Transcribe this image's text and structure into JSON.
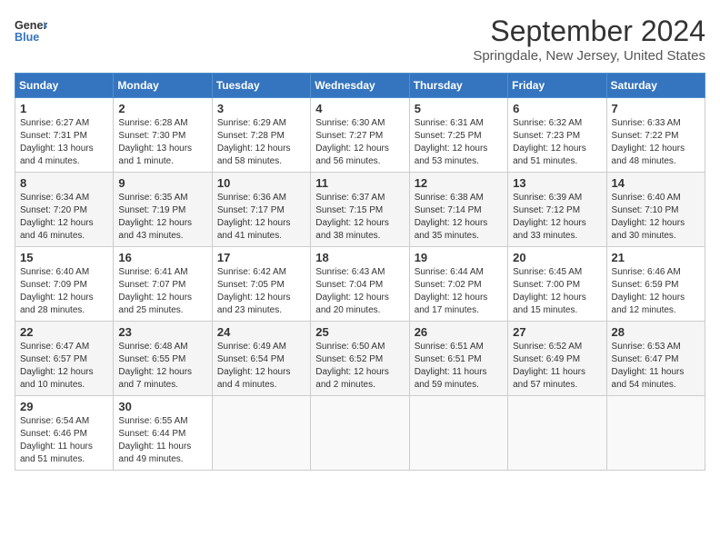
{
  "header": {
    "logo_line1": "General",
    "logo_line2": "Blue",
    "month": "September 2024",
    "location": "Springdale, New Jersey, United States"
  },
  "days_of_week": [
    "Sunday",
    "Monday",
    "Tuesday",
    "Wednesday",
    "Thursday",
    "Friday",
    "Saturday"
  ],
  "weeks": [
    [
      {
        "num": "1",
        "sunrise": "6:27 AM",
        "sunset": "7:31 PM",
        "daylight": "13 hours and 4 minutes."
      },
      {
        "num": "2",
        "sunrise": "6:28 AM",
        "sunset": "7:30 PM",
        "daylight": "13 hours and 1 minute."
      },
      {
        "num": "3",
        "sunrise": "6:29 AM",
        "sunset": "7:28 PM",
        "daylight": "12 hours and 58 minutes."
      },
      {
        "num": "4",
        "sunrise": "6:30 AM",
        "sunset": "7:27 PM",
        "daylight": "12 hours and 56 minutes."
      },
      {
        "num": "5",
        "sunrise": "6:31 AM",
        "sunset": "7:25 PM",
        "daylight": "12 hours and 53 minutes."
      },
      {
        "num": "6",
        "sunrise": "6:32 AM",
        "sunset": "7:23 PM",
        "daylight": "12 hours and 51 minutes."
      },
      {
        "num": "7",
        "sunrise": "6:33 AM",
        "sunset": "7:22 PM",
        "daylight": "12 hours and 48 minutes."
      }
    ],
    [
      {
        "num": "8",
        "sunrise": "6:34 AM",
        "sunset": "7:20 PM",
        "daylight": "12 hours and 46 minutes."
      },
      {
        "num": "9",
        "sunrise": "6:35 AM",
        "sunset": "7:19 PM",
        "daylight": "12 hours and 43 minutes."
      },
      {
        "num": "10",
        "sunrise": "6:36 AM",
        "sunset": "7:17 PM",
        "daylight": "12 hours and 41 minutes."
      },
      {
        "num": "11",
        "sunrise": "6:37 AM",
        "sunset": "7:15 PM",
        "daylight": "12 hours and 38 minutes."
      },
      {
        "num": "12",
        "sunrise": "6:38 AM",
        "sunset": "7:14 PM",
        "daylight": "12 hours and 35 minutes."
      },
      {
        "num": "13",
        "sunrise": "6:39 AM",
        "sunset": "7:12 PM",
        "daylight": "12 hours and 33 minutes."
      },
      {
        "num": "14",
        "sunrise": "6:40 AM",
        "sunset": "7:10 PM",
        "daylight": "12 hours and 30 minutes."
      }
    ],
    [
      {
        "num": "15",
        "sunrise": "6:40 AM",
        "sunset": "7:09 PM",
        "daylight": "12 hours and 28 minutes."
      },
      {
        "num": "16",
        "sunrise": "6:41 AM",
        "sunset": "7:07 PM",
        "daylight": "12 hours and 25 minutes."
      },
      {
        "num": "17",
        "sunrise": "6:42 AM",
        "sunset": "7:05 PM",
        "daylight": "12 hours and 23 minutes."
      },
      {
        "num": "18",
        "sunrise": "6:43 AM",
        "sunset": "7:04 PM",
        "daylight": "12 hours and 20 minutes."
      },
      {
        "num": "19",
        "sunrise": "6:44 AM",
        "sunset": "7:02 PM",
        "daylight": "12 hours and 17 minutes."
      },
      {
        "num": "20",
        "sunrise": "6:45 AM",
        "sunset": "7:00 PM",
        "daylight": "12 hours and 15 minutes."
      },
      {
        "num": "21",
        "sunrise": "6:46 AM",
        "sunset": "6:59 PM",
        "daylight": "12 hours and 12 minutes."
      }
    ],
    [
      {
        "num": "22",
        "sunrise": "6:47 AM",
        "sunset": "6:57 PM",
        "daylight": "12 hours and 10 minutes."
      },
      {
        "num": "23",
        "sunrise": "6:48 AM",
        "sunset": "6:55 PM",
        "daylight": "12 hours and 7 minutes."
      },
      {
        "num": "24",
        "sunrise": "6:49 AM",
        "sunset": "6:54 PM",
        "daylight": "12 hours and 4 minutes."
      },
      {
        "num": "25",
        "sunrise": "6:50 AM",
        "sunset": "6:52 PM",
        "daylight": "12 hours and 2 minutes."
      },
      {
        "num": "26",
        "sunrise": "6:51 AM",
        "sunset": "6:51 PM",
        "daylight": "11 hours and 59 minutes."
      },
      {
        "num": "27",
        "sunrise": "6:52 AM",
        "sunset": "6:49 PM",
        "daylight": "11 hours and 57 minutes."
      },
      {
        "num": "28",
        "sunrise": "6:53 AM",
        "sunset": "6:47 PM",
        "daylight": "11 hours and 54 minutes."
      }
    ],
    [
      {
        "num": "29",
        "sunrise": "6:54 AM",
        "sunset": "6:46 PM",
        "daylight": "11 hours and 51 minutes."
      },
      {
        "num": "30",
        "sunrise": "6:55 AM",
        "sunset": "6:44 PM",
        "daylight": "11 hours and 49 minutes."
      },
      {
        "num": "",
        "sunrise": "",
        "sunset": "",
        "daylight": ""
      },
      {
        "num": "",
        "sunrise": "",
        "sunset": "",
        "daylight": ""
      },
      {
        "num": "",
        "sunrise": "",
        "sunset": "",
        "daylight": ""
      },
      {
        "num": "",
        "sunrise": "",
        "sunset": "",
        "daylight": ""
      },
      {
        "num": "",
        "sunrise": "",
        "sunset": "",
        "daylight": ""
      }
    ]
  ]
}
